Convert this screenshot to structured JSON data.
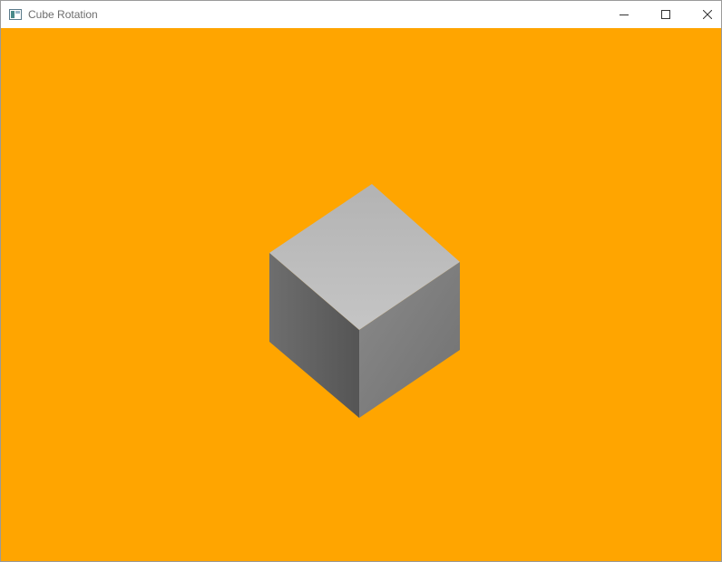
{
  "window": {
    "title": "Cube Rotation",
    "app_icon": "app-window-icon",
    "controls": {
      "minimize_icon": "minimize-icon",
      "maximize_icon": "maximize-icon",
      "close_icon": "close-icon"
    }
  },
  "scene": {
    "background_color": "#FFA500",
    "object": "cube",
    "colors": {
      "top_face_light": "#c5c5c5",
      "top_face_dark": "#b3b3b3",
      "left_face_light": "#6e6e6e",
      "left_face_dark": "#555555",
      "right_face_light": "#8a8a8a",
      "right_face_dark": "#717171"
    }
  }
}
